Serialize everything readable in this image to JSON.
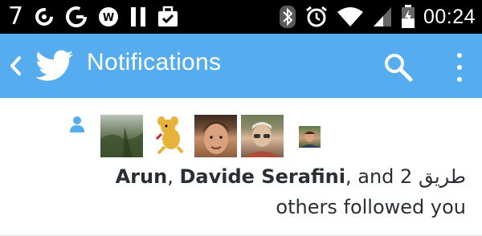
{
  "status_bar": {
    "notification_count": "7",
    "time": "00:24",
    "icons": [
      "refresh-icon",
      "g-icon",
      "w-icon",
      "pause-icon",
      "briefcase-check-icon",
      "bluetooth-icon",
      "alarm-icon",
      "wifi-icon",
      "signal-icon",
      "battery-icon"
    ]
  },
  "app_bar": {
    "title": "Notifications",
    "color": "#55acee",
    "icons": [
      "back-icon",
      "twitter-bird-icon",
      "search-icon",
      "overflow-menu-icon"
    ]
  },
  "notification": {
    "type_icon": "person-follow-icon",
    "avatars": [
      "avatar-1",
      "avatar-2",
      "avatar-3",
      "avatar-4",
      "avatar-5"
    ],
    "user1": "Arun",
    "sep1": ",",
    "user2": "Davide Serafini",
    "sep2": ", and 2",
    "user3": "طريق",
    "line2": "others followed you"
  }
}
